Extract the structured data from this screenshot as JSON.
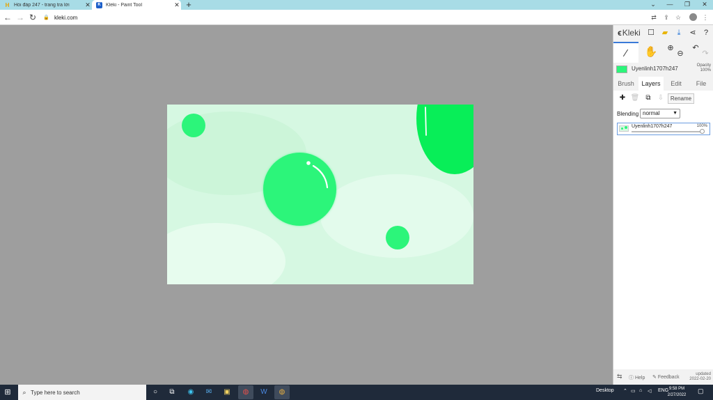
{
  "browser": {
    "tabs": [
      {
        "title": "Hỏi đáp 247 - trang tra lời",
        "icon": "hoidap-favicon",
        "active": false
      },
      {
        "title": "Kleki - Paint Tool",
        "icon": "kleki-favicon",
        "active": true
      }
    ],
    "url": "kleki.com"
  },
  "kleki": {
    "logo_text": "Kleki",
    "layer_owner": "Uyenlinh1707h247",
    "opacity_label": "Opacity",
    "opacity_value": "100%",
    "tabs": [
      "Brush",
      "Layers",
      "Edit",
      "File"
    ],
    "active_tab": "Layers",
    "rename_label": "Rename",
    "blending_label": "Blending",
    "blending_value": "normal",
    "layers": [
      {
        "name": "Uyenlinh1707h247",
        "opacity": "100%",
        "opacity_fraction": 1.0
      }
    ],
    "footer": {
      "help": "Help",
      "feedback": "Feedback",
      "updated_label": "updated",
      "updated_date": "2022-02-20"
    },
    "colors": {
      "canvas_bg": "#d6f8e2",
      "bubble": "#2cf57a",
      "bubble_dark": "#08ee58",
      "accent": "#3a7ad8"
    }
  },
  "taskbar": {
    "search_placeholder": "Type here to search",
    "desktop_label": "Desktop",
    "language": "ENG",
    "time": "9:58 PM",
    "date": "2/27/2022"
  }
}
